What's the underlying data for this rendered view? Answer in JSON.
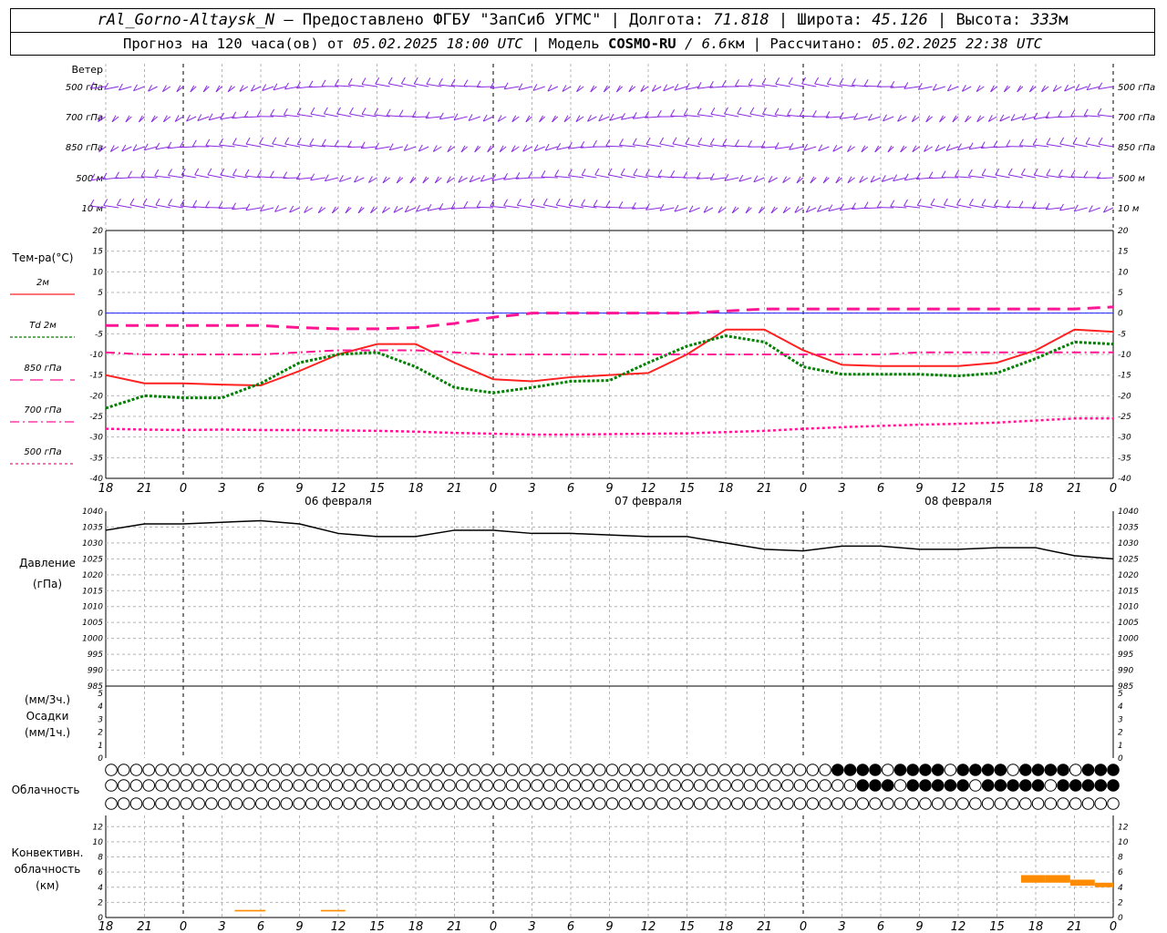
{
  "header": {
    "station": "rAl_Gorno-Altaysk_N",
    "provider": "– Предоставлено ФГБУ \"ЗапСиб УГМС\" |",
    "lon_label": "Долгота:",
    "lon_value": "71.818",
    "lat_label": "| Широта:",
    "lat_value": "45.126",
    "alt_label": "| Высота:",
    "alt_value": "333",
    "alt_unit": "м",
    "forecast_text": "Прогноз на 120 часа(ов) от",
    "forecast_time": "05.02.2025 18:00 UTC",
    "model_label": "| Модель",
    "model_name": "COSMO-RU",
    "model_res": "/ 6.6",
    "model_res_unit": "км",
    "calc_label": "| Рассчитано:",
    "calc_time": "05.02.2025 22:38 UTC"
  },
  "colors": {
    "wind": "#8a2be2",
    "t2m": "#ff2020",
    "td2m": "#008000",
    "t850": "#ff1493",
    "pressure": "#000000",
    "conv": "#ff8c00",
    "grid": "#b4b4b4",
    "zero_line": "#0000ff"
  },
  "chart_data": [
    {
      "type": "wind-barbs",
      "panel_title": "Ветер",
      "levels": [
        "500 гПа",
        "700 гПа",
        "850 гПа",
        "500 м",
        "10 м"
      ]
    },
    {
      "type": "line",
      "panel_title": "Тем-ра(°С)",
      "ylim": [
        -40,
        20
      ],
      "yticks": [
        20,
        15,
        10,
        5,
        0,
        -5,
        -10,
        -15,
        -20,
        -25,
        -30,
        -35,
        -40
      ],
      "xlabels_hours": [
        "18",
        "21",
        "0",
        "3",
        "6",
        "9",
        "12",
        "15",
        "18",
        "21",
        "0",
        "3",
        "6",
        "9",
        "12",
        "15",
        "18",
        "21",
        "0",
        "3",
        "6",
        "9",
        "12",
        "15",
        "18",
        "21",
        "0"
      ],
      "date_labels": [
        "06 февраля",
        "07 февраля",
        "08 февраля"
      ],
      "x_hours": [
        0,
        3,
        6,
        9,
        12,
        15,
        18,
        21,
        24,
        27,
        30,
        33,
        36,
        39,
        42,
        45,
        48,
        51,
        54,
        57,
        60,
        63,
        66,
        69,
        72,
        75,
        78
      ],
      "series": [
        {
          "name": "2м",
          "style": "solid",
          "values": [
            -15,
            -17,
            -17,
            -17.3,
            -17.5,
            -14,
            -10,
            -7.5,
            -7.5,
            -12,
            -16,
            -16.5,
            -15.5,
            -15,
            -14.5,
            -10,
            -4,
            -4,
            -9,
            -12.5,
            -12.8,
            -12.8,
            -12.8,
            -12,
            -9,
            -4,
            -4.5
          ]
        },
        {
          "name": "Td 2м",
          "style": "dotted",
          "values": [
            -23,
            -20,
            -20.5,
            -20.5,
            -17,
            -12,
            -10,
            -9.5,
            -13,
            -18,
            -19.3,
            -18,
            -16.5,
            -16.3,
            -12,
            -8,
            -5.5,
            -7,
            -13,
            -14.8,
            -14.8,
            -14.8,
            -15.2,
            -14.5,
            -11,
            -7,
            -7.5
          ]
        },
        {
          "name": "850 гПа",
          "style": "dashed",
          "values": [
            -3,
            -3,
            -3,
            -3,
            -3,
            -3.5,
            -3.8,
            -3.8,
            -3.5,
            -2.5,
            -1,
            0,
            0,
            0,
            0,
            0,
            0.5,
            1,
            1,
            1,
            1,
            1,
            1,
            1,
            1,
            1,
            1.5
          ]
        },
        {
          "name": "700 гПа",
          "style": "dashdot",
          "values": [
            -9.5,
            -10,
            -10,
            -10,
            -10,
            -9.5,
            -9,
            -9,
            -9,
            -9.5,
            -10,
            -10,
            -10,
            -10,
            -10,
            -10,
            -10,
            -10,
            -10,
            -10,
            -10,
            -9.5,
            -9.5,
            -9.5,
            -9.5,
            -9.5,
            -9.5
          ]
        },
        {
          "name": "500 гПа",
          "style": "dotted",
          "values": [
            -28,
            -28.2,
            -28.3,
            -28.2,
            -28.3,
            -28.3,
            -28.4,
            -28.5,
            -28.7,
            -29,
            -29.2,
            -29.4,
            -29.4,
            -29.3,
            -29.2,
            -29.1,
            -28.8,
            -28.5,
            -28,
            -27.6,
            -27.3,
            -27,
            -26.8,
            -26.5,
            -26,
            -25.5,
            -25.5
          ]
        }
      ]
    },
    {
      "type": "line",
      "panel_title": "Давление",
      "panel_unit": "(гПа)",
      "ylim": [
        985,
        1040
      ],
      "yticks": [
        1040,
        1035,
        1030,
        1025,
        1020,
        1015,
        1010,
        1005,
        1000,
        995,
        990,
        985
      ],
      "x_hours": [
        0,
        3,
        6,
        9,
        12,
        15,
        18,
        21,
        24,
        27,
        30,
        33,
        36,
        39,
        42,
        45,
        48,
        51,
        54,
        57,
        60,
        63,
        66,
        69,
        72,
        75,
        78
      ],
      "series": [
        {
          "name": "",
          "values": [
            1034,
            1036,
            1036,
            1036.5,
            1037,
            1036,
            1033,
            1032,
            1032,
            1034,
            1034,
            1033,
            1033,
            1032.5,
            1032,
            1032,
            1030,
            1028,
            1027.5,
            1029,
            1029,
            1028,
            1028,
            1028.5,
            1028.5,
            1026,
            1025
          ]
        }
      ]
    },
    {
      "type": "bar",
      "panel_title": "Осадки",
      "panel_unit_top": "(мм/3ч.)",
      "panel_unit_bottom": "(мм/1ч.)",
      "ylim": [
        0,
        5
      ],
      "yticks": [
        5,
        4,
        3,
        2,
        1,
        0
      ],
      "values": []
    },
    {
      "type": "cloud-symbols",
      "panel_title": "Облачность",
      "rows": 3
    },
    {
      "type": "bar",
      "panel_title_1": "Конвективн.",
      "panel_title_2": "облачность",
      "panel_unit": "(км)",
      "ylim": [
        0,
        13
      ],
      "yticks": [
        12,
        10,
        8,
        6,
        4,
        2,
        0
      ],
      "bars": [
        {
          "x_start_hour": 10.5,
          "x_end_hour": 13,
          "bottom": 0.8,
          "top": 1.0
        },
        {
          "x_start_hour": 17.5,
          "x_end_hour": 19.5,
          "bottom": 0.8,
          "top": 1.0
        },
        {
          "x_start_hour": 74.5,
          "x_end_hour": 76.5,
          "bottom": 4.6,
          "top": 5.6
        },
        {
          "x_start_hour": 76.5,
          "x_end_hour": 78.5,
          "bottom": 4.6,
          "top": 5.6
        },
        {
          "x_start_hour": 78.5,
          "x_end_hour": 80.5,
          "bottom": 4.2,
          "top": 5.0
        },
        {
          "x_start_hour": 80.5,
          "x_end_hour": 82,
          "bottom": 4.0,
          "top": 4.6
        }
      ]
    }
  ]
}
